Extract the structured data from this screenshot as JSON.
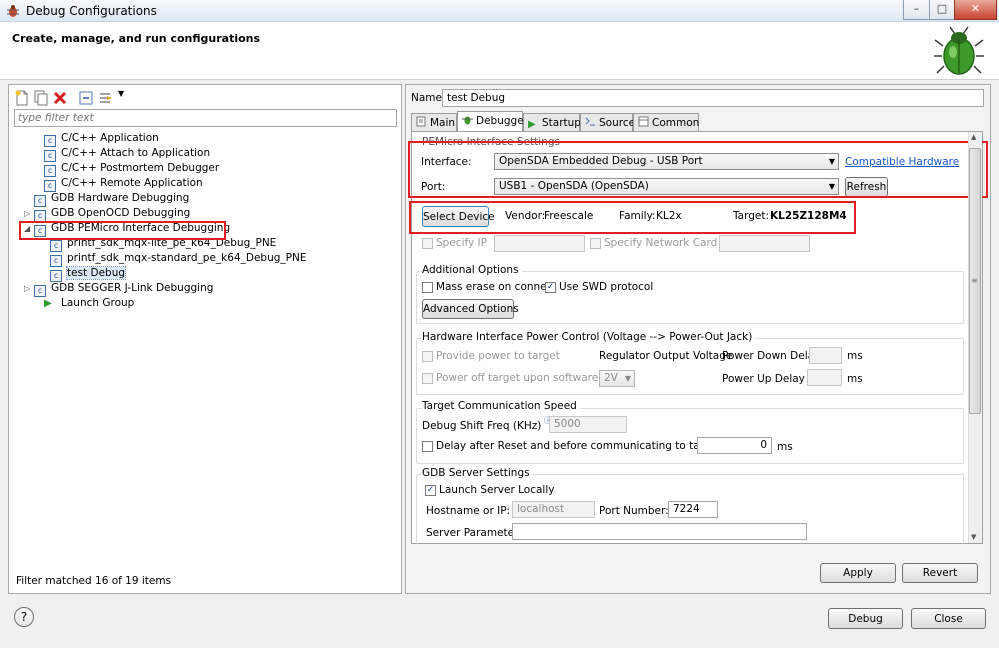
{
  "window": {
    "title": "Debug Configurations",
    "header_title": "Create, manage, and run configurations",
    "controls": {
      "minimize": "–",
      "maximize": "□",
      "close": "✕"
    }
  },
  "left": {
    "filter_placeholder": "type filter text",
    "tree": [
      {
        "label": "C/C++ Application",
        "level": 0,
        "expander": ""
      },
      {
        "label": "C/C++ Attach to Application",
        "level": 0,
        "expander": ""
      },
      {
        "label": "C/C++ Postmortem Debugger",
        "level": 0,
        "expander": ""
      },
      {
        "label": "C/C++ Remote Application",
        "level": 0,
        "expander": ""
      },
      {
        "label": "GDB Hardware Debugging",
        "level": 0,
        "expander": ""
      },
      {
        "label": "GDB OpenOCD Debugging",
        "level": 0,
        "expander": "▷"
      },
      {
        "label": "GDB PEMicro Interface Debugging",
        "level": 0,
        "expander": "◢"
      },
      {
        "label": "printf_sdk_mqx-lite_pe_k64_Debug_PNE",
        "level": 1,
        "expander": ""
      },
      {
        "label": "printf_sdk_mqx-standard_pe_k64_Debug_PNE",
        "level": 1,
        "expander": ""
      },
      {
        "label": "test Debug",
        "level": 1,
        "expander": ""
      },
      {
        "label": "GDB SEGGER J-Link Debugging",
        "level": 0,
        "expander": "▷"
      },
      {
        "label": "Launch Group",
        "level": 0,
        "expander": ""
      }
    ],
    "status": "Filter matched 16 of 19 items"
  },
  "right": {
    "name_label": "Name:",
    "name_value": "test Debug",
    "tabs": [
      {
        "label": "Main"
      },
      {
        "label": "Debugger"
      },
      {
        "label": "Startup"
      },
      {
        "label": "Source"
      },
      {
        "label": "Common"
      }
    ],
    "pemicro": {
      "title": "PEMicro Interface Settings",
      "interface_label": "Interface:",
      "interface_value": "OpenSDA Embedded Debug - USB Port",
      "compatible_link": "Compatible Hardware",
      "port_label": "Port:",
      "port_value": "USB1 - OpenSDA (OpenSDA)",
      "refresh": "Refresh",
      "select_device": "Select Device",
      "vendor_label": "Vendor:",
      "vendor_value": "Freescale",
      "family_label": "Family:",
      "family_value": "KL2x",
      "target_label": "Target:",
      "target_value": "KL25Z128M4",
      "specify_ip": "Specify IP",
      "specify_network": "Specify Network Card IP"
    },
    "additional": {
      "title": "Additional Options",
      "mass_erase": "Mass erase on connect",
      "use_swd": "Use SWD protocol",
      "advanced": "Advanced Options"
    },
    "power": {
      "title": "Hardware Interface Power Control (Voltage --> Power-Out Jack)",
      "provide_power": "Provide power to target",
      "regulator": "Regulator Output Voltage",
      "power_down": "Power Down Delay",
      "ms1": "ms",
      "power_off": "Power off target upon software exit",
      "voltage": "2V",
      "power_up": "Power Up Delay",
      "ms2": "ms"
    },
    "speed": {
      "title": "Target Communication Speed",
      "shift_label": "Debug Shift Freq (KHz)",
      "shift_value": "5000",
      "delay_label": "Delay after Reset and before communicating to target for",
      "delay_value": "0",
      "ms": "ms"
    },
    "gdb": {
      "title": "GDB Server Settings",
      "launch_locally": "Launch Server Locally",
      "hostname_label": "Hostname or IP:",
      "hostname_value": "localhost",
      "port_label": "Port Number:",
      "port_value": "7224",
      "params_label": "Server Parameters:",
      "params_value": ""
    },
    "apply": "Apply",
    "revert": "Revert"
  },
  "footer": {
    "help": "?",
    "debug": "Debug",
    "close": "Close"
  },
  "colors": {
    "highlight": "#e02020",
    "link": "#1a56c8"
  }
}
